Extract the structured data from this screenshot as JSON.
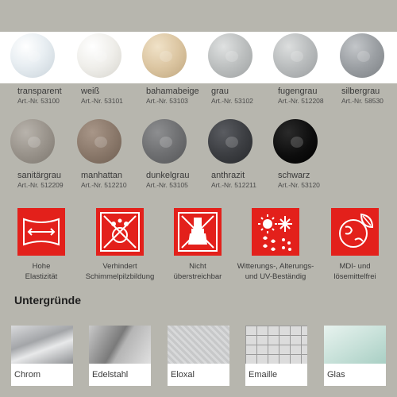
{
  "colors": [
    {
      "name": "transparent",
      "art": "Art.-Nr. 53100",
      "hex": "#e8eef2"
    },
    {
      "name": "weiß",
      "art": "Art.-Nr. 53101",
      "hex": "#efeeea"
    },
    {
      "name": "bahamabeige",
      "art": "Art.-Nr. 53103",
      "hex": "#dcc6a2"
    },
    {
      "name": "grau",
      "art": "Art.-Nr. 53102",
      "hex": "#bcbfbf"
    },
    {
      "name": "fugengrau",
      "art": "Art.-Nr. 512208",
      "hex": "#b9bcbd"
    },
    {
      "name": "silbergrau",
      "art": "Art.-Nr. 58530",
      "hex": "#9b9fa3"
    },
    {
      "name": "sanitärgrau",
      "art": "Art.-Nr. 512209",
      "hex": "#9a948c"
    },
    {
      "name": "manhattan",
      "art": "Art.-Nr. 512210",
      "hex": "#8c7a6c"
    },
    {
      "name": "dunkelgrau",
      "art": "Art.-Nr. 53105",
      "hex": "#6f7072"
    },
    {
      "name": "anthrazit",
      "art": "Art.-Nr. 512211",
      "hex": "#3d3f43"
    },
    {
      "name": "schwarz",
      "art": "Art.-Nr. 53120",
      "hex": "#0d0d0d"
    }
  ],
  "features": [
    {
      "icon": "elasticity-icon",
      "line1": "Hohe",
      "line2": "Elastizität"
    },
    {
      "icon": "mold-prevention-icon",
      "line1": "Verhindert",
      "line2": "Schimmelpilzbildung"
    },
    {
      "icon": "not-paintable-icon",
      "line1": "Nicht",
      "line2": "überstreichbar"
    },
    {
      "icon": "weather-resistant-icon",
      "line1": "Witterungs-, Alterungs-",
      "line2": "und UV-Beständig"
    },
    {
      "icon": "solvent-free-icon",
      "line1": "MDI- und",
      "line2": "lösemittelfrei"
    }
  ],
  "substrates_title": "Untergründe",
  "substrates": [
    {
      "name": "Chrom",
      "icon": "chrome-surface-image"
    },
    {
      "name": "Edelstahl",
      "icon": "stainless-steel-image"
    },
    {
      "name": "Eloxal",
      "icon": "anodized-aluminium-image"
    },
    {
      "name": "Emaille",
      "icon": "enamel-tiles-image"
    },
    {
      "name": "Glas",
      "icon": "glass-pane-image"
    }
  ],
  "accent": "#e3201b",
  "background": "#b7b6ae"
}
